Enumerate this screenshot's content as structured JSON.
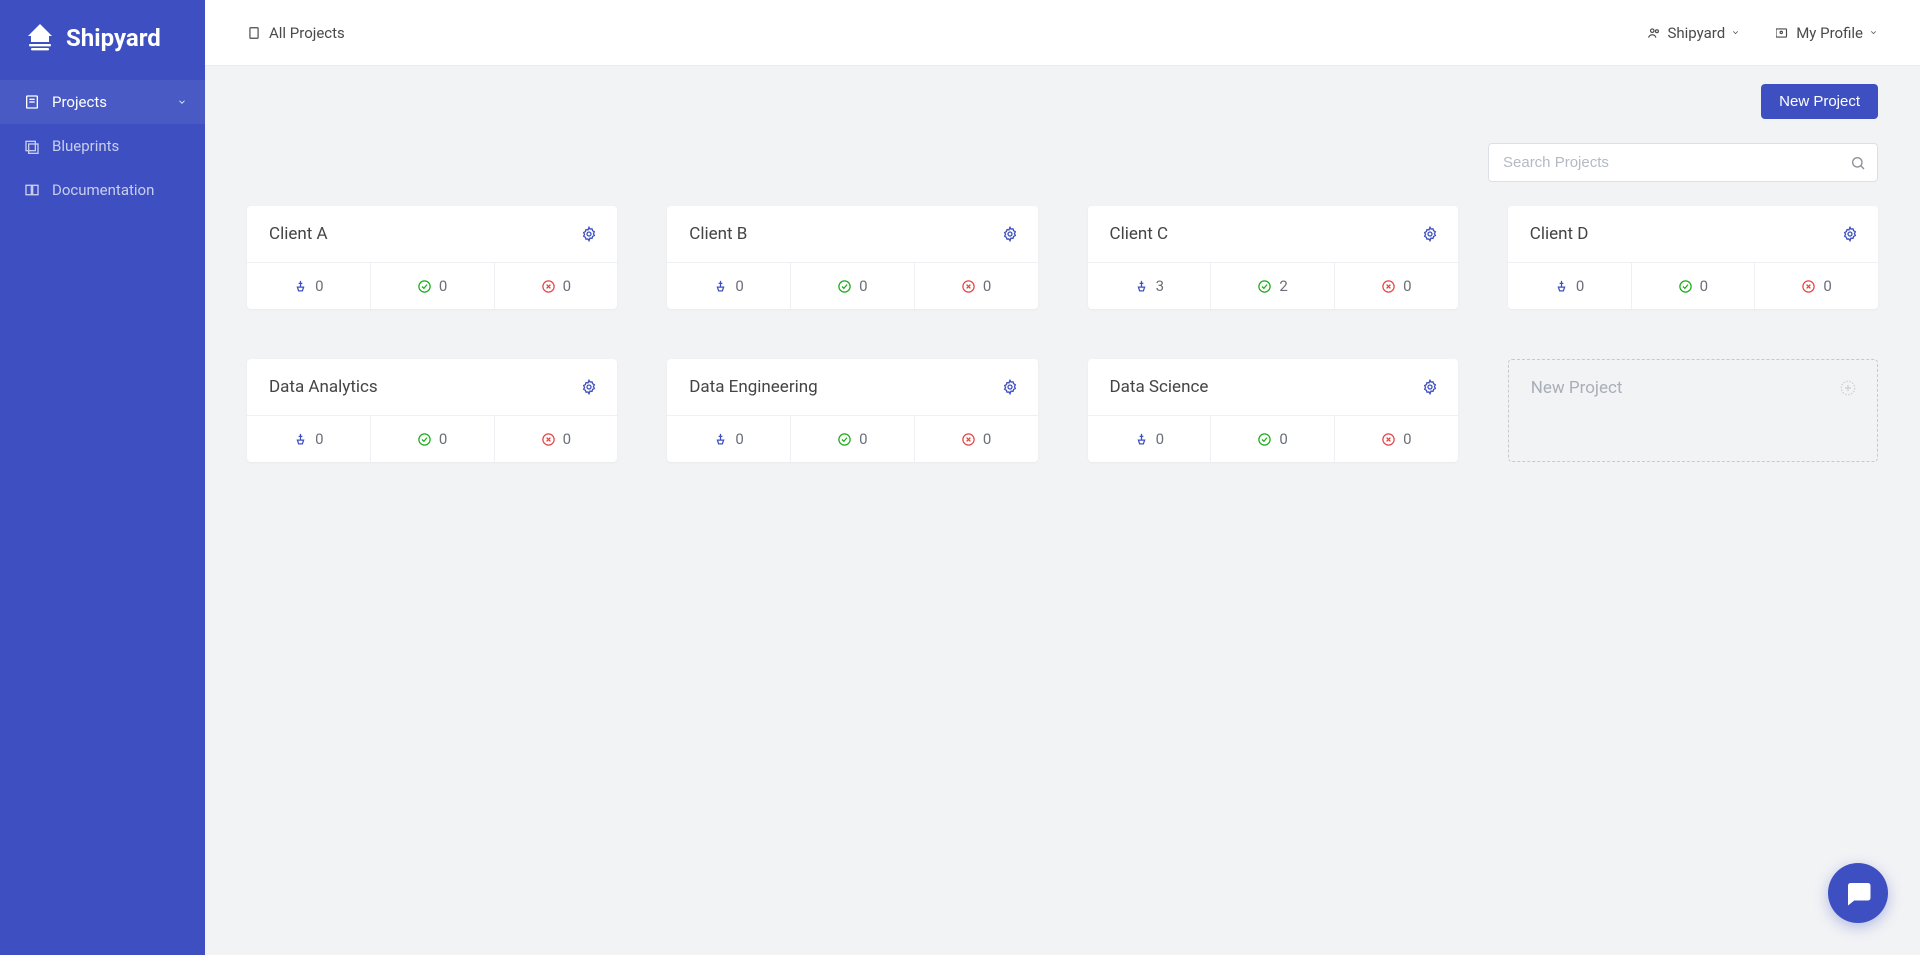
{
  "brand": "Shipyard",
  "sidebar": {
    "items": [
      {
        "label": "Projects",
        "active": true,
        "expandable": true
      },
      {
        "label": "Blueprints",
        "active": false,
        "expandable": false
      },
      {
        "label": "Documentation",
        "active": false,
        "expandable": false
      }
    ]
  },
  "header": {
    "breadcrumb": "All Projects",
    "org": "Shipyard",
    "profile": "My Profile"
  },
  "toolbar": {
    "new_project_label": "New Project"
  },
  "search": {
    "placeholder": "Search Projects"
  },
  "projects": [
    {
      "name": "Client A",
      "vessels": 0,
      "succeeded": 0,
      "errored": 0
    },
    {
      "name": "Client B",
      "vessels": 0,
      "succeeded": 0,
      "errored": 0
    },
    {
      "name": "Client C",
      "vessels": 3,
      "succeeded": 2,
      "errored": 0
    },
    {
      "name": "Client D",
      "vessels": 0,
      "succeeded": 0,
      "errored": 0
    },
    {
      "name": "Data Analytics",
      "vessels": 0,
      "succeeded": 0,
      "errored": 0
    },
    {
      "name": "Data Engineering",
      "vessels": 0,
      "succeeded": 0,
      "errored": 0
    },
    {
      "name": "Data Science",
      "vessels": 0,
      "succeeded": 0,
      "errored": 0
    }
  ],
  "ghost_card_label": "New Project"
}
